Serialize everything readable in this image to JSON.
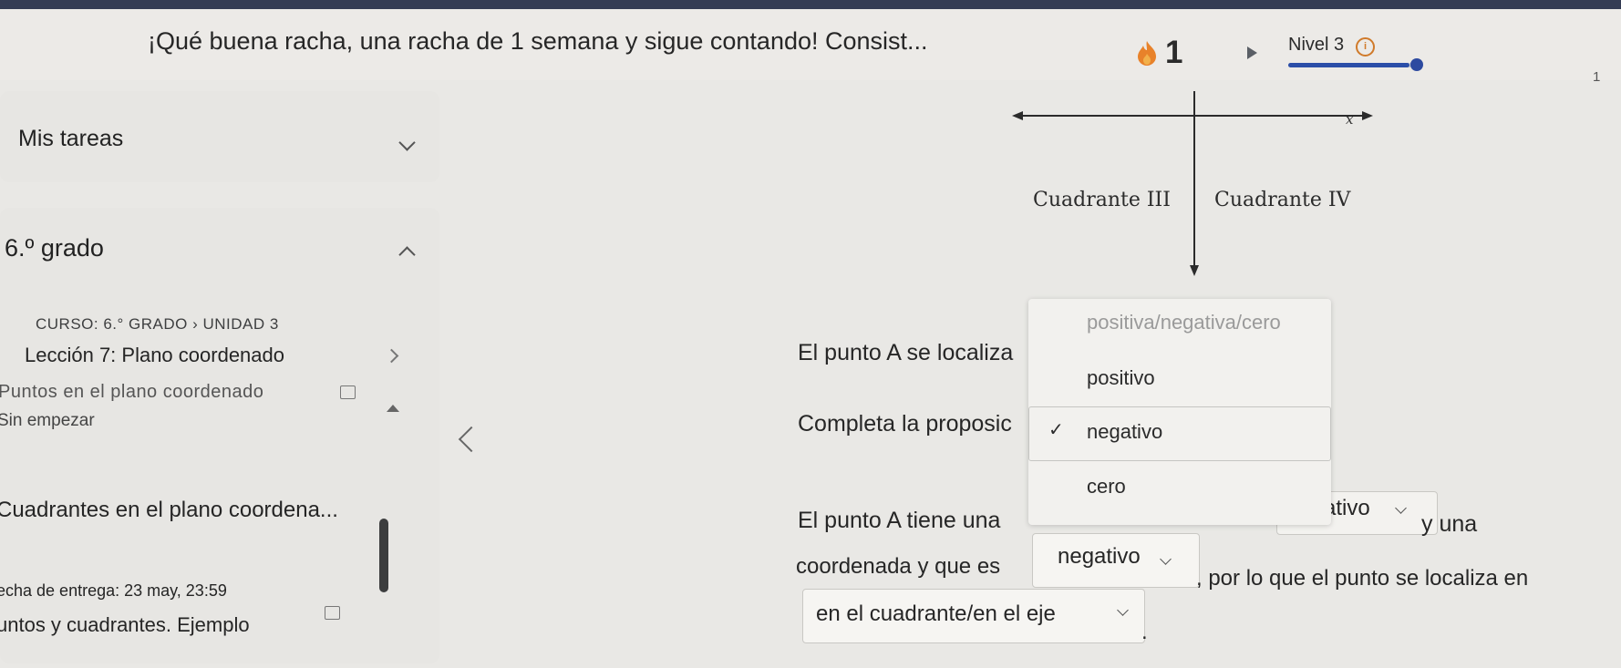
{
  "header": {
    "streak_message": "¡Qué buena racha, una racha de 1 semana y sigue contando! Consist...",
    "streak_count": "1",
    "level_label": "Nivel 3",
    "info_glyph": "i",
    "level_progress_fraction": 0.95,
    "page_indicator": "1",
    "accent_color": "#2b4ea8",
    "streak_icon": "flame-icon"
  },
  "sidebar": {
    "tasks_title": "Mis tareas",
    "grade_title": "6.º grado",
    "breadcrumb": "CURSO: 6.° GRADO › UNIDAD 3",
    "lesson_title": "Lección 7: Plano coordenado",
    "activity_title": "Puntos en el plano coordenado",
    "activity_status": "Sin empezar",
    "next_activity_title": "Cuadrantes en el plano coordena...",
    "due_date": "echa de entrega: 23 may, 23:59",
    "next_subtitle": "untos y cuadrantes. Ejemplo"
  },
  "diagram": {
    "x_axis_label": "x",
    "quadrant_iii": "Cuadrante III",
    "quadrant_iv": "Cuadrante IV"
  },
  "question": {
    "line1": "El punto A se localiza",
    "line2": "Completa la proposic",
    "line3_start": "El punto A tiene una",
    "dropdown_coord_value": "ativo",
    "line3_end": "y una",
    "line4_start": "coordenada y que es",
    "dropdown_y_value": "negativo",
    "line4_end": ", por lo que el punto se localiza en",
    "dropdown_location_value": "en el cuadrante/en el eje",
    "period": "."
  },
  "dropdown_menu": {
    "placeholder": "positiva/negativa/cero",
    "options": [
      "positivo",
      "negativo",
      "cero"
    ],
    "selected_index": 1,
    "check_glyph": "✓"
  }
}
